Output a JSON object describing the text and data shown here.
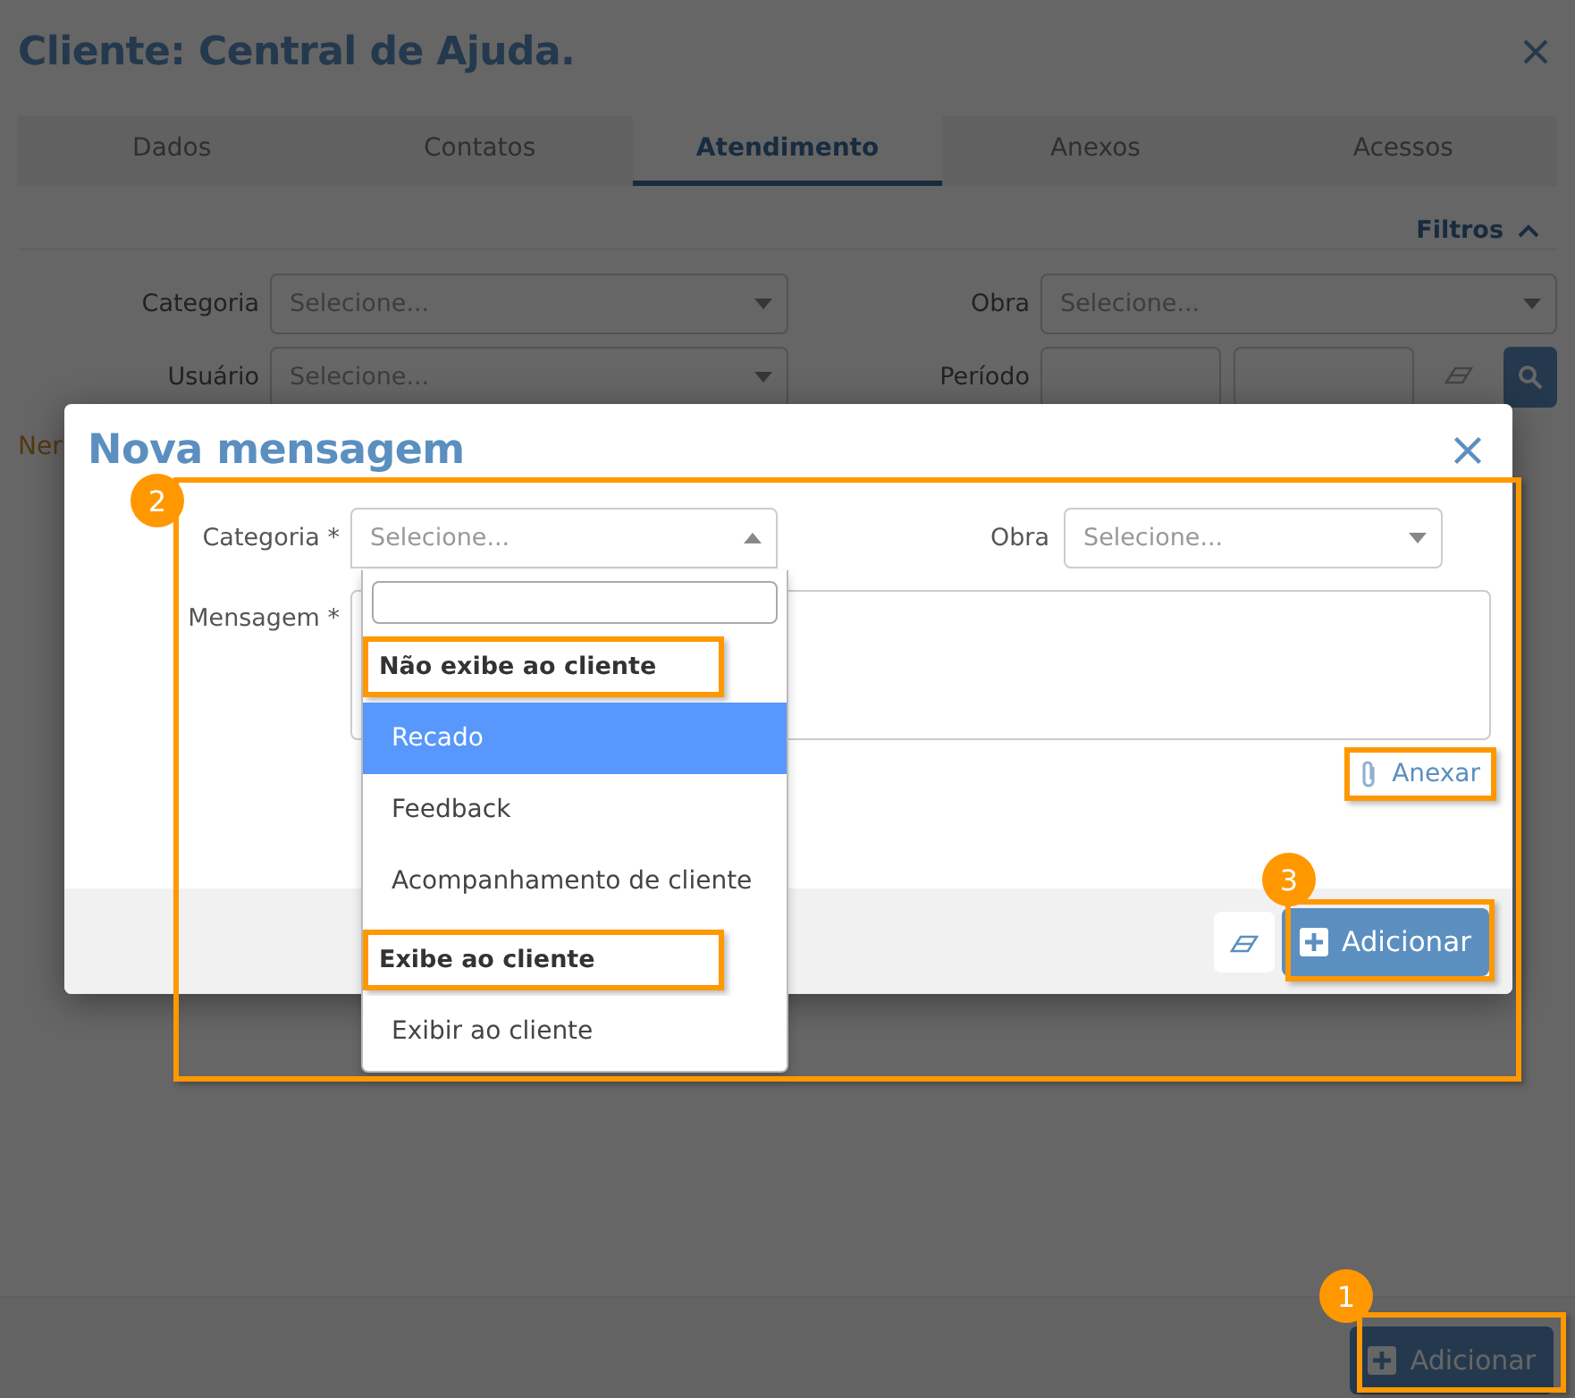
{
  "page": {
    "title": "Cliente: Central de Ajuda.",
    "tabs": [
      {
        "label": "Dados",
        "selected": false
      },
      {
        "label": "Contatos",
        "selected": false
      },
      {
        "label": "Atendimento",
        "selected": true
      },
      {
        "label": "Anexos",
        "selected": false
      },
      {
        "label": "Acessos",
        "selected": false
      }
    ],
    "filters_toggle": "Filtros",
    "filters": {
      "categoria": {
        "label": "Categoria",
        "placeholder": "Selecione..."
      },
      "obra": {
        "label": "Obra",
        "placeholder": "Selecione..."
      },
      "usuario": {
        "label": "Usuário",
        "placeholder": "Selecione..."
      },
      "periodo": {
        "label": "Período"
      }
    },
    "note": "Ner",
    "add_button": "Adicionar"
  },
  "modal": {
    "title": "Nova mensagem",
    "categoria": {
      "label": "Categoria *",
      "placeholder": "Selecione...",
      "expanded": true
    },
    "obra": {
      "label": "Obra",
      "placeholder": "Selecione..."
    },
    "mensagem": {
      "label": "Mensagem *"
    },
    "dropdown": {
      "groups": [
        {
          "label": "Não exibe ao cliente",
          "options": [
            {
              "label": "Recado",
              "selected": true
            },
            {
              "label": "Feedback",
              "selected": false
            },
            {
              "label": "Acompanhamento de cliente",
              "selected": false
            }
          ]
        },
        {
          "label": "Exibe ao cliente",
          "options": [
            {
              "label": "Exibir ao cliente",
              "selected": false
            }
          ]
        }
      ]
    },
    "attach_button": "Anexar",
    "submit_button": "Adicionar"
  },
  "annotations": [
    {
      "number": "1"
    },
    {
      "number": "2"
    },
    {
      "number": "3"
    }
  ]
}
